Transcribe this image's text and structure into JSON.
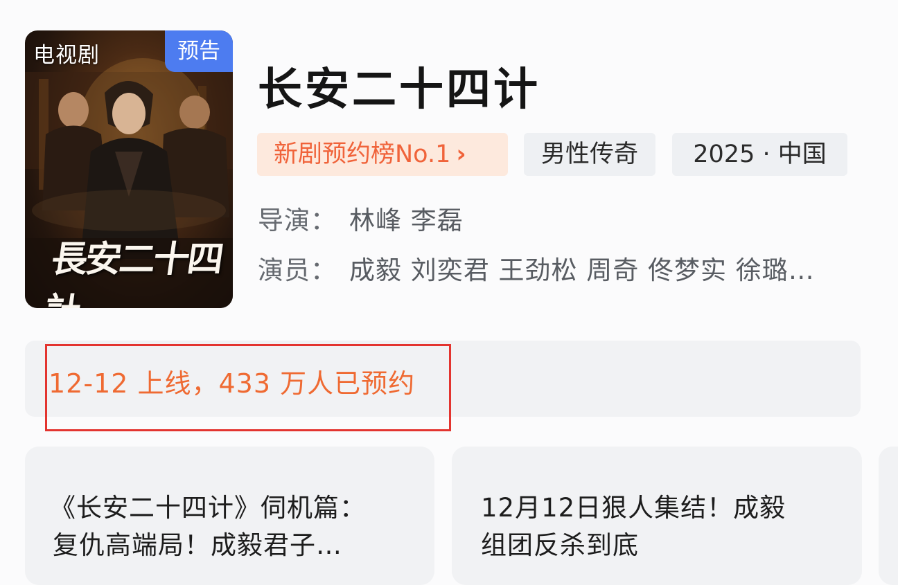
{
  "show": {
    "poster": {
      "kind_label": "电视剧",
      "badge": "预告",
      "logo_text": "長安二十四計"
    },
    "title": "长安二十四计",
    "tags": {
      "rank": "新剧预约榜No.1",
      "rank_chevron": "›",
      "genre": "男性传奇",
      "year_region": "2025 · 中国"
    },
    "director": {
      "label": "导演：",
      "value": "林峰 李磊"
    },
    "cast": {
      "label": "演员：",
      "value": "成毅 刘奕君 王劲松 周奇 佟梦实 徐璐…"
    }
  },
  "release": {
    "text": "12-12 上线，433 万人已预约"
  },
  "cards": [
    {
      "line1": "《长安二十四计》伺机篇：",
      "line2": "复仇高端局！成毅君子…"
    },
    {
      "line1": "12月12日狠人集结！成毅",
      "line2": "组团反杀到底"
    }
  ],
  "colors": {
    "badge_blue": "#4d7cf0",
    "rank_text": "#f0633a",
    "rank_bg": "#fde9dd",
    "release_text": "#ef6a32",
    "highlight_red": "#e3342f"
  },
  "icons": {
    "rank_chevron": "chevron-right-icon"
  }
}
